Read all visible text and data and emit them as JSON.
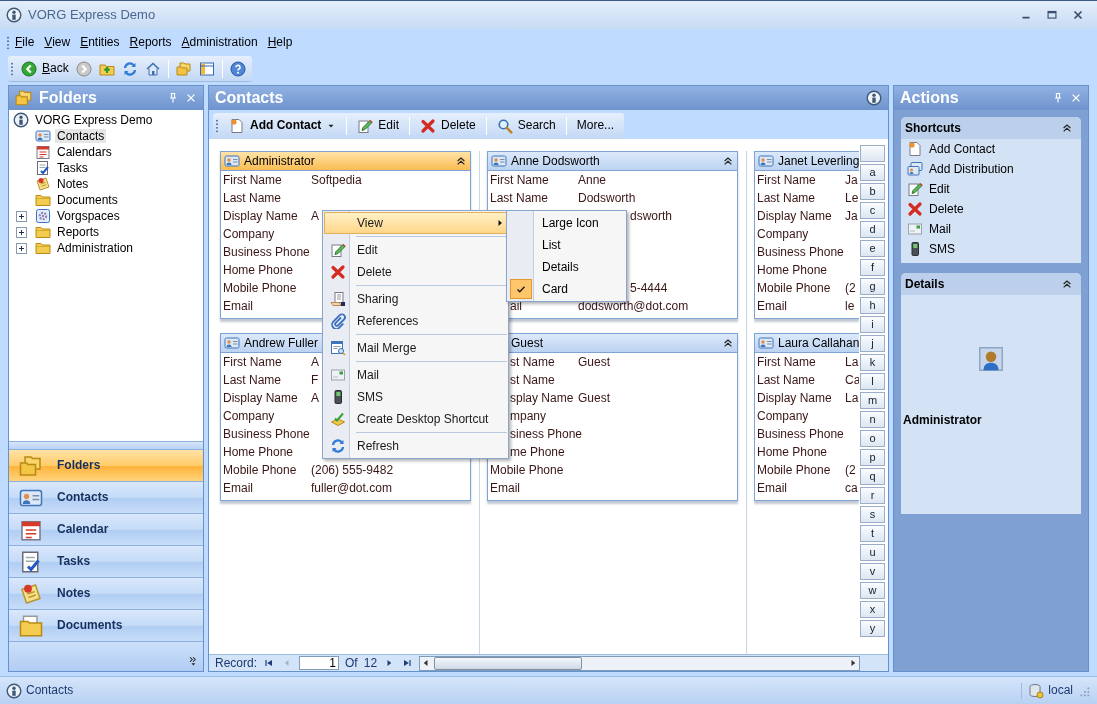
{
  "window": {
    "title": "VORG Express Demo"
  },
  "menu_bar": [
    "File",
    "View",
    "Entities",
    "Reports",
    "Administration",
    "Help"
  ],
  "toolbar": {
    "back_label": "Back",
    "forward_disabled": true
  },
  "folders_panel": {
    "title": "Folders",
    "tree": [
      {
        "label": "VORG Express Demo",
        "selected": false,
        "children": [
          {
            "label": "Contacts",
            "kind": "leaf",
            "selected": true
          },
          {
            "label": "Calendars",
            "kind": "leaf",
            "selected": false
          },
          {
            "label": "Tasks",
            "kind": "leaf",
            "selected": false
          },
          {
            "label": "Notes",
            "kind": "leaf",
            "selected": false
          },
          {
            "label": "Documents",
            "kind": "leaf",
            "selected": false
          },
          {
            "label": "Vorgspaces",
            "kind": "group",
            "expanded": false,
            "selected": false
          },
          {
            "label": "Reports",
            "kind": "group",
            "expanded": false,
            "selected": false
          },
          {
            "label": "Administration",
            "kind": "group",
            "expanded": false,
            "selected": false
          }
        ]
      }
    ]
  },
  "navigation": [
    {
      "label": "Folders",
      "selected": true
    },
    {
      "label": "Contacts",
      "selected": false
    },
    {
      "label": "Calendar",
      "selected": false
    },
    {
      "label": "Tasks",
      "selected": false
    },
    {
      "label": "Notes",
      "selected": false
    },
    {
      "label": "Documents",
      "selected": false
    }
  ],
  "contacts_panel": {
    "title": "Contacts",
    "toolbar": [
      {
        "label": "Add Contact",
        "kind": "dropdown"
      },
      {
        "label": "Edit",
        "kind": "button"
      },
      {
        "label": "Delete",
        "kind": "button"
      },
      {
        "label": "Search",
        "kind": "button"
      },
      {
        "label": "More...",
        "kind": "text"
      }
    ],
    "card_columns": [
      {
        "cards": [
          {
            "name": "Administrator",
            "selected": true,
            "fields": [
              {
                "label": "First Name",
                "value": "Softpedia"
              },
              {
                "label": "Last Name"
              },
              {
                "label": "Display Name",
                "value": "A"
              },
              {
                "label": "Company"
              },
              {
                "label": "Business Phone"
              },
              {
                "label": "Home Phone"
              },
              {
                "label": "Mobile Phone"
              },
              {
                "label": "Email"
              }
            ]
          },
          {
            "name": "Andrew Fuller",
            "selected": false,
            "fields": [
              {
                "label": "First Name",
                "value": "A"
              },
              {
                "label": "Last Name",
                "value": "F"
              },
              {
                "label": "Display Name",
                "value": "A"
              },
              {
                "label": "Company"
              },
              {
                "label": "Business Phone"
              },
              {
                "label": "Home Phone"
              },
              {
                "label": "Mobile Phone",
                "value": "(206) 555-9482"
              },
              {
                "label": "Email",
                "value": "fuller@dot.com"
              }
            ]
          }
        ]
      },
      {
        "cards": [
          {
            "name": "Anne Dodsworth",
            "selected": false,
            "fields": [
              {
                "label": "First Name",
                "value": "Anne"
              },
              {
                "label": "Last Name",
                "value": "Dodsworth"
              },
              {
                "value": "dsworth"
              },
              {
                "value": "5-4444"
              },
              {
                "label": "ail",
                "value": "dodsworth@dot.com"
              }
            ]
          },
          {
            "name": "Guest",
            "selected": false,
            "fields": [
              {
                "label": "st Name",
                "value": "Guest"
              },
              {
                "label": "st Name"
              },
              {
                "label": "splay Name",
                "value": "Guest"
              },
              {
                "label": "mpany"
              },
              {
                "label": "siness Phone"
              },
              {
                "label": "me Phone"
              },
              {
                "label": "Mobile Phone"
              },
              {
                "label": "Email"
              }
            ]
          }
        ]
      },
      {
        "cards": [
          {
            "name": "Janet Leverling",
            "selected": false,
            "fields": [
              {
                "label": "First Name",
                "value": "Ja"
              },
              {
                "label": "Last Name",
                "value": "Le"
              },
              {
                "label": "Display Name",
                "value": "Ja"
              },
              {
                "label": "Company"
              },
              {
                "label": "Business Phone"
              },
              {
                "label": "Home Phone"
              },
              {
                "label": "Mobile Phone",
                "value": "(2"
              },
              {
                "label": "Email",
                "value": "le"
              }
            ]
          },
          {
            "name": "Laura Callahan",
            "selected": false,
            "fields": [
              {
                "label": "First Name",
                "value": "La"
              },
              {
                "label": "Last Name",
                "value": "Ca"
              },
              {
                "label": "Display Name",
                "value": "La"
              },
              {
                "label": "Company"
              },
              {
                "label": "Business Phone"
              },
              {
                "label": "Home Phone"
              },
              {
                "label": "Mobile Phone",
                "value": "(2"
              },
              {
                "label": "Email",
                "value": "ca"
              }
            ]
          }
        ]
      }
    ],
    "alphabet": [
      "a",
      "b",
      "c",
      "d",
      "e",
      "f",
      "g",
      "h",
      "i",
      "j",
      "k",
      "l",
      "m",
      "n",
      "o",
      "p",
      "q",
      "r",
      "s",
      "t",
      "u",
      "v",
      "w",
      "x",
      "y"
    ],
    "record_bar": {
      "label": "Record:",
      "current": "1",
      "of_label": "Of",
      "total": "12",
      "prev_disabled": true
    }
  },
  "context_menu": {
    "items": [
      {
        "kind": "submenu",
        "label": "View",
        "selected": true
      },
      {
        "kind": "separator"
      },
      {
        "kind": "item",
        "label": "Edit",
        "selected": false
      },
      {
        "kind": "item",
        "label": "Delete",
        "selected": false
      },
      {
        "kind": "separator"
      },
      {
        "kind": "item",
        "label": "Sharing",
        "selected": false
      },
      {
        "kind": "item",
        "label": "References",
        "selected": false
      },
      {
        "kind": "separator"
      },
      {
        "kind": "item",
        "label": "Mail Merge",
        "selected": false
      },
      {
        "kind": "separator"
      },
      {
        "kind": "item",
        "label": "Mail",
        "selected": false
      },
      {
        "kind": "item",
        "label": "SMS",
        "selected": false
      },
      {
        "kind": "item",
        "label": "Create Desktop Shortcut",
        "selected": false
      },
      {
        "kind": "separator"
      },
      {
        "kind": "item",
        "label": "Refresh",
        "selected": false
      }
    ],
    "submenu": [
      {
        "label": "Large Icon",
        "checked": false
      },
      {
        "label": "List",
        "checked": false
      },
      {
        "label": "Details",
        "checked": false
      },
      {
        "label": "Card",
        "checked": true
      }
    ]
  },
  "actions_panel": {
    "title": "Actions",
    "shortcuts": {
      "title": "Shortcuts",
      "items": [
        "Add Contact",
        "Add Distribution",
        "Edit",
        "Delete",
        "Mail",
        "SMS"
      ]
    },
    "details": {
      "title": "Details",
      "name": "Administrator"
    }
  },
  "status_bar": {
    "left": "Contacts",
    "right": "local"
  }
}
